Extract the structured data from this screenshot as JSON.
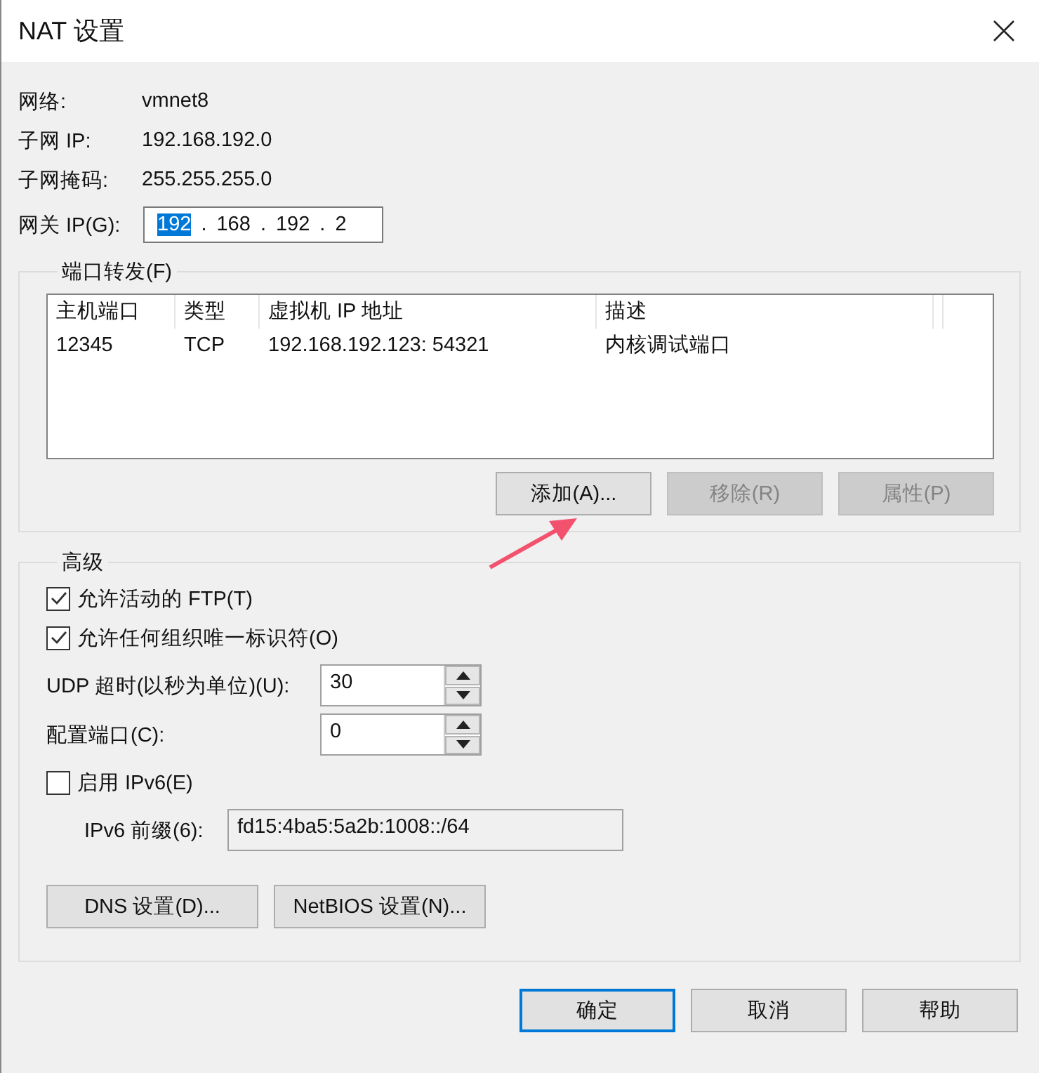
{
  "window": {
    "title": "NAT 设置"
  },
  "info": [
    {
      "label": "网络:",
      "value": "vmnet8"
    },
    {
      "label": "子网 IP:",
      "value": "192.168.192.0"
    },
    {
      "label": "子网掩码:",
      "value": "255.255.255.0"
    }
  ],
  "gateway": {
    "label": "网关 IP(G):",
    "dot": ".",
    "octets": [
      {
        "text": "192",
        "selected": true
      },
      {
        "text": "168",
        "selected": false
      },
      {
        "text": "192",
        "selected": false
      },
      {
        "text": "2",
        "selected": false
      }
    ]
  },
  "port_forwarding": {
    "title": "端口转发(F)",
    "columns": [
      "主机端口",
      "类型",
      "虚拟机 IP 地址",
      "描述"
    ],
    "rows": [
      [
        "12345",
        "TCP",
        "192.168.192.123: 54321",
        "内核调试端口"
      ]
    ],
    "buttons": [
      {
        "label": "添加(A)...",
        "disabled": false
      },
      {
        "label": "移除(R)",
        "disabled": true
      },
      {
        "label": "属性(P)",
        "disabled": true
      }
    ]
  },
  "advanced": {
    "title": "高级",
    "items": [
      {
        "kind": "checkbox",
        "label": "允许活动的 FTP(T)",
        "checked": true
      },
      {
        "kind": "checkbox",
        "label": "允许任何组织唯一标识符(O)",
        "checked": true
      },
      {
        "kind": "spinner",
        "label": "UDP 超时(以秒为单位)(U):",
        "value": "30"
      },
      {
        "kind": "spinner",
        "label": "配置端口(C):",
        "value": "0"
      },
      {
        "kind": "checkbox",
        "label": "启用 IPv6(E)",
        "checked": false
      },
      {
        "kind": "readonly_field",
        "label": "IPv6 前缀(6):",
        "value": "fd15:4ba5:5a2b:1008::/64"
      }
    ],
    "buttons": [
      {
        "label": "DNS 设置(D)..."
      },
      {
        "label": "NetBIOS 设置(N)..."
      }
    ]
  },
  "footer_buttons": [
    {
      "label": "确定",
      "default": true
    },
    {
      "label": "取消",
      "default": false
    },
    {
      "label": "帮助",
      "default": false
    }
  ]
}
